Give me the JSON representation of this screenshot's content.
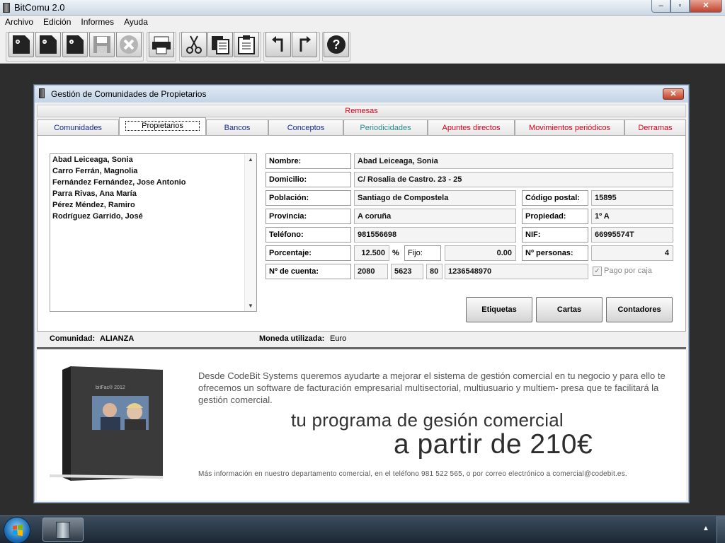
{
  "app": {
    "title": "BitComu 2.0"
  },
  "window_controls": {
    "minimize": "–",
    "maximize": "▫",
    "close": "✕"
  },
  "menu": [
    "Archivo",
    "Edición",
    "Informes",
    "Ayuda"
  ],
  "toolbar": {
    "icons": [
      "new-doc-plus-icon",
      "new-doc-minus-icon",
      "doc-info-icon",
      "save-icon",
      "cancel-icon",
      "print-icon",
      "cut-icon",
      "copy-icon",
      "paste-icon",
      "undo-icon",
      "redo-icon",
      "help-icon"
    ]
  },
  "child_window": {
    "title": "Gestión de Comunidades de Propietarios",
    "close": "✕",
    "remesas": "Remesas",
    "tabs": [
      {
        "label": "Comunidades",
        "color": "#1a2a8a"
      },
      {
        "label": "Propietarios",
        "color": "#000000"
      },
      {
        "label": "Bancos",
        "color": "#1a2a8a"
      },
      {
        "label": "Conceptos",
        "color": "#1a2a8a"
      },
      {
        "label": "Periodicidades",
        "color": "#2a8a8a"
      },
      {
        "label": "Apuntes directos",
        "color": "#d4001a"
      },
      {
        "label": "Movimientos periódicos",
        "color": "#d4001a"
      },
      {
        "label": "Derramas",
        "color": "#d4001a"
      }
    ],
    "owners": [
      "Abad Leiceaga, Sonia",
      "Carro Ferrán, Magnolia",
      "Fernández Fernández, Jose Antonio",
      "Parra Rivas, Ana María",
      "Pérez Méndez, Ramiro",
      "Rodríguez Garrido, José"
    ],
    "form": {
      "nombre_label": "Nombre:",
      "nombre": "Abad Leiceaga, Sonia",
      "domicilio_label": "Domicilio:",
      "domicilio": "C/ Rosalia de Castro. 23 - 25",
      "poblacion_label": "Población:",
      "poblacion": "Santiago de Compostela",
      "cp_label": "Código postal:",
      "cp": "15895",
      "provincia_label": "Provincia:",
      "provincia": "A coruña",
      "propiedad_label": "Propiedad:",
      "propiedad": "1º A",
      "telefono_label": "Teléfono:",
      "telefono": "981556698",
      "nif_label": "NIF:",
      "nif": "66995574T",
      "porcentaje_label": "Porcentaje:",
      "porcentaje": "12.500",
      "pct_sign": "%",
      "fijo_label": "Fijo:",
      "fijo": "0.00",
      "personas_label": "Nº personas:",
      "personas": "4",
      "cuenta_label": "Nº de cuenta:",
      "cuenta_1": "2080",
      "cuenta_2": "5623",
      "cuenta_3": "80",
      "cuenta_4": "1236548970",
      "pago_caja_label": "Pago por caja",
      "pago_caja_check": "✓"
    },
    "buttons": {
      "etiquetas": "Etiquetas",
      "cartas": "Cartas",
      "contadores": "Contadores"
    },
    "status": {
      "comunidad_label": "Comunidad:",
      "comunidad": "ALIANZA",
      "moneda_label": "Moneda utilizada:",
      "moneda": "Euro"
    },
    "ad": {
      "box_label": "bitFac® 2012",
      "text1": "Desde CodeBit Systems queremos ayudarte a mejorar el sistema de gestión comercial en tu negocio y para ello te ofrecemos un software de facturación empresarial multisectorial, multiusuario y multiem- presa que te facilitará la gestión comercial.",
      "text2": "tu programa de gesión comercial",
      "text3": "a partir de 210€",
      "text4": "Más información en nuestro departamento comercial, en el teléfono 981 522 565, o por correo electrónico a comercial@codebit.es."
    }
  },
  "taskbar": {
    "tray_arrow": "▲"
  }
}
